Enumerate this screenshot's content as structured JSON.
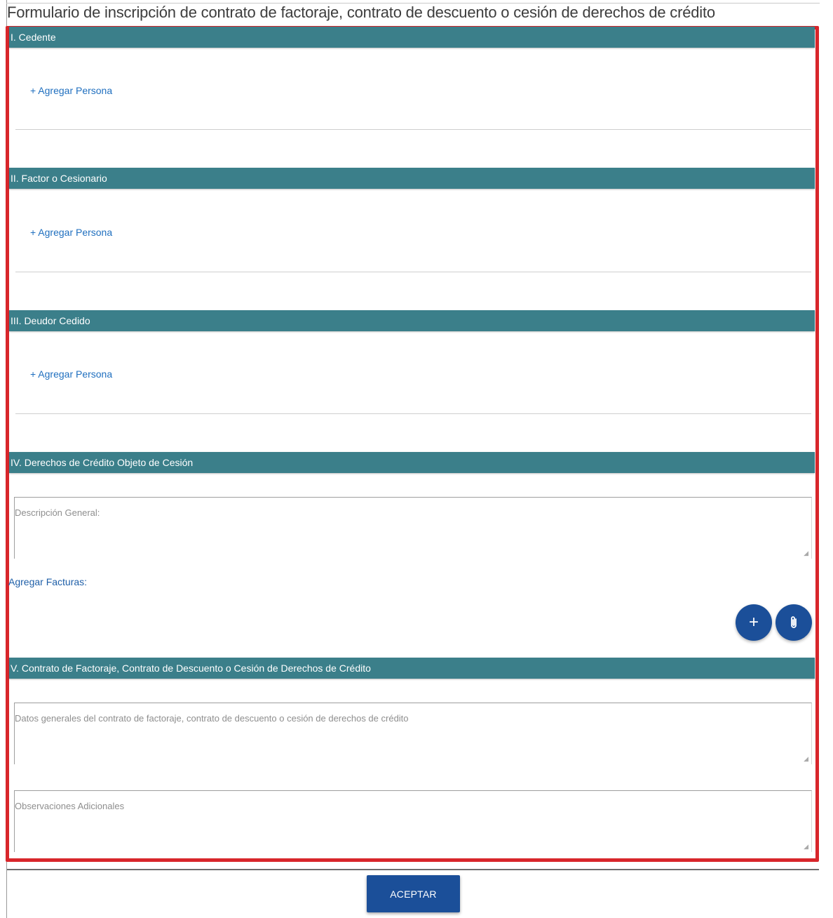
{
  "page": {
    "title": "Formulario de inscripción de contrato de factoraje, contrato de descuento o cesión de derechos de crédito"
  },
  "sections": {
    "cedente": {
      "title": "I. Cedente",
      "add_person_label": "+ Agregar Persona"
    },
    "factor": {
      "title": "II. Factor o Cesionario",
      "add_person_label": "+ Agregar Persona"
    },
    "deudor": {
      "title": "III. Deudor Cedido",
      "add_person_label": "+ Agregar Persona"
    },
    "derechos": {
      "title": "IV. Derechos de Crédito Objeto de Cesión",
      "description_placeholder": "Descripción General:",
      "invoices_label": "Agregar Facturas:"
    },
    "contrato": {
      "title": "V. Contrato de Factoraje, Contrato de Descuento o Cesión de Derechos de Crédito",
      "general_data_placeholder": "Datos generales del contrato de factoraje, contrato de descuento o cesión de derechos de crédito",
      "observations_placeholder": "Observaciones Adicionales"
    }
  },
  "actions": {
    "add_invoice_icon": "plus-icon",
    "attach_file_icon": "paperclip-icon",
    "accept_label": "ACEPTAR"
  },
  "colors": {
    "section_bar": "#3b7f8a",
    "link": "#1f6fbf",
    "button": "#1b4f99",
    "highlight_frame": "#d8262b"
  }
}
